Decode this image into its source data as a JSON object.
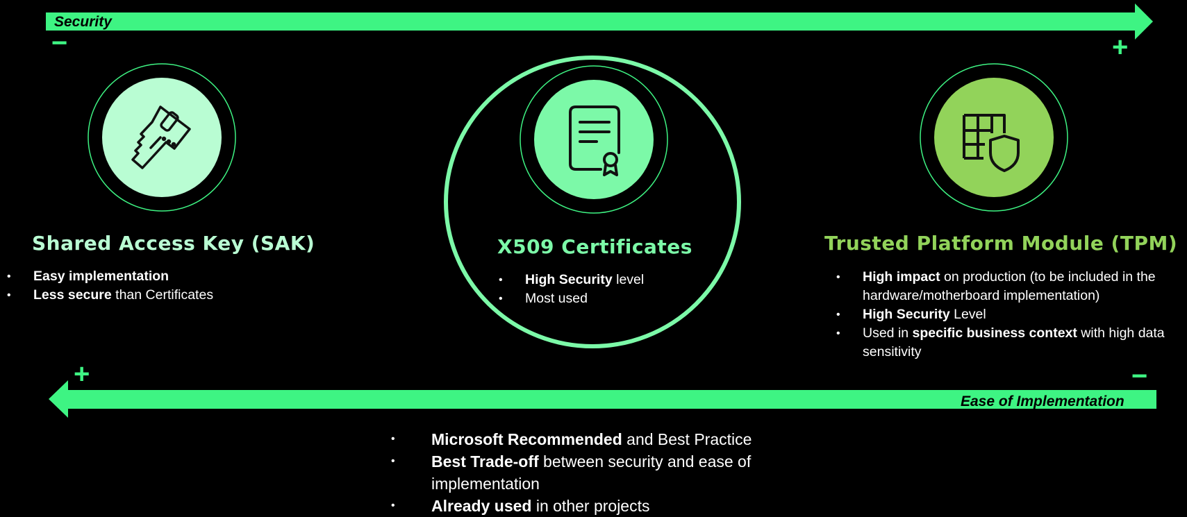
{
  "colors": {
    "arrow": "#3ef483",
    "sak_circle": "#b9fdd3",
    "x509_circle": "#7cf9a8",
    "tpm_circle": "#92d35a"
  },
  "security_arrow": {
    "label": "Security",
    "left_sign": "−",
    "right_sign": "+"
  },
  "ease_arrow": {
    "label": "Ease of Implementation",
    "left_sign": "+",
    "right_sign": "−"
  },
  "sak": {
    "icon": "key-icon",
    "title": "Shared Access Key (SAK)",
    "bullets": [
      {
        "bold": "Easy implementation",
        "rest": ""
      },
      {
        "bold": "Less secure",
        "rest": " than Certificates"
      }
    ]
  },
  "x509": {
    "icon": "certificate-icon",
    "title": "X509 Certificates",
    "bullets": [
      {
        "bold": "High Security",
        "rest": " level"
      },
      {
        "bold": "",
        "rest": "Most used"
      }
    ]
  },
  "tpm": {
    "icon": "shield-chip-icon",
    "title": "Trusted Platform Module (TPM)",
    "bullets": [
      {
        "bold": "High impact",
        "rest": " on production (to be included in the hardware/motherboard implementation)"
      },
      {
        "bold": "High Security",
        "rest": " Level"
      },
      {
        "pre": "Used in ",
        "bold": "specific business context",
        "rest": " with high data sensitivity"
      }
    ]
  },
  "recommendation": {
    "bullets": [
      {
        "bold": "Microsoft Recommended",
        "rest": " and Best Practice"
      },
      {
        "bold": "Best Trade-off",
        "rest": " between security and ease of implementation"
      },
      {
        "bold": "Already used",
        "rest": " in other projects"
      }
    ]
  }
}
